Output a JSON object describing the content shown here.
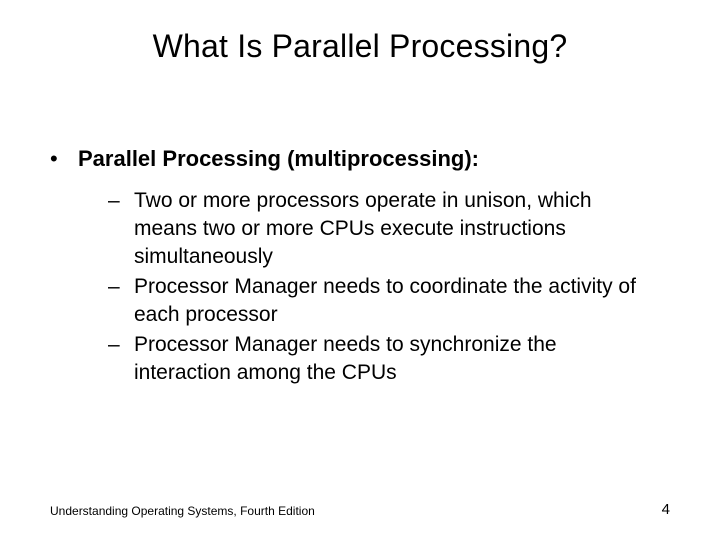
{
  "title": "What Is Parallel Processing?",
  "bullet": {
    "label": "Parallel Processing (multiprocessing):",
    "subs": [
      "Two or more processors operate in unison, which means two or more CPUs execute instructions simultaneously",
      "Processor Manager needs to coordinate the activity of each processor",
      "Processor Manager needs to synchronize the interaction among the CPUs"
    ]
  },
  "footer": {
    "source": "Understanding Operating Systems, Fourth Edition",
    "page": "4"
  }
}
